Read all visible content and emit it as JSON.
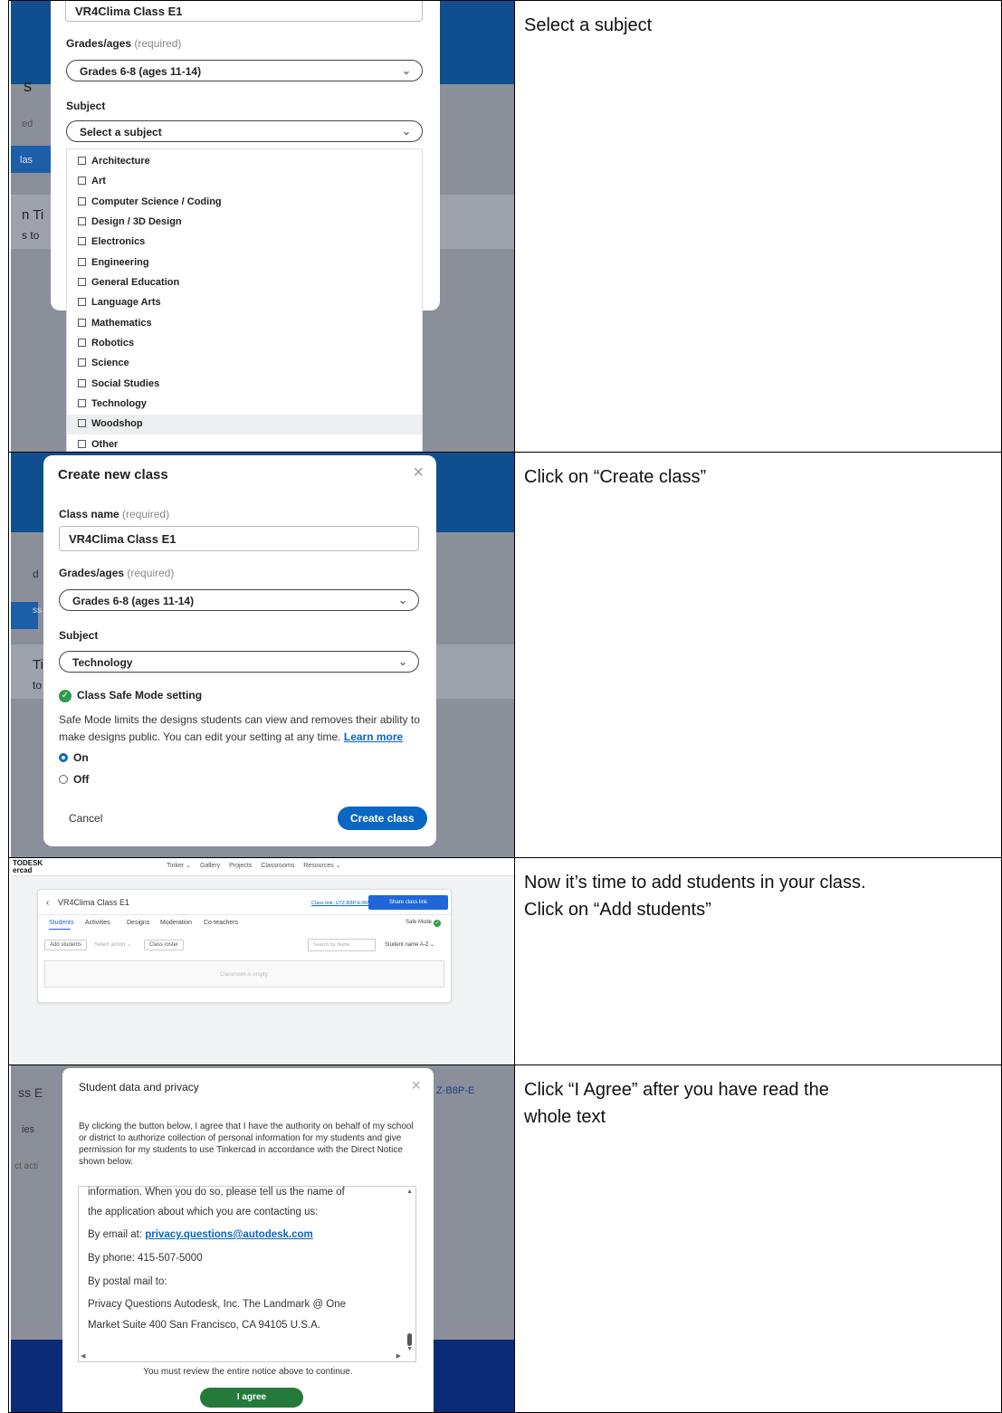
{
  "steps": [
    {
      "instruction": "Select a subject",
      "screen": {
        "class_name_value": "VR4Clima Class E1",
        "grades_label": "Grades/ages",
        "required_text": "(required)",
        "grades_value": "Grades 6-8 (ages 11-14)",
        "subject_label": "Subject",
        "subject_placeholder": "Select a subject",
        "bg_fragments": [
          "s",
          "ed",
          "las",
          "n Ti",
          "s to"
        ],
        "subjects": [
          "Architecture",
          "Art",
          "Computer Science / Coding",
          "Design / 3D Design",
          "Electronics",
          "Engineering",
          "General Education",
          "Language Arts",
          "Mathematics",
          "Robotics",
          "Science",
          "Social Studies",
          "Technology",
          "Woodshop",
          "Other"
        ],
        "highlighted": "Woodshop"
      }
    },
    {
      "instruction": "Click on “Create class”",
      "screen": {
        "title": "Create new class",
        "class_name_label": "Class name",
        "required_text": "(required)",
        "class_name_value": "VR4Clima Class E1",
        "grades_label": "Grades/ages",
        "grades_value": "Grades 6-8 (ages 11-14)",
        "subject_label": "Subject",
        "subject_value": "Technology",
        "safe_mode_heading": "Class Safe Mode setting",
        "safe_mode_text_1": "Safe Mode limits the designs students can view and removes their ability to",
        "safe_mode_text_2": "make designs public. You can edit your setting at any time.",
        "learn_more": "Learn more",
        "radio_on": "On",
        "radio_off": "Off",
        "cancel": "Cancel",
        "create": "Create class",
        "bg_fragments": [
          "d",
          "ss",
          "Ti",
          "to"
        ]
      }
    },
    {
      "instruction_1": "Now it’s time to add students in your class.",
      "instruction_2": "Click on “Add students”",
      "screen": {
        "logo_1": "TODESK",
        "logo_2": "ercad",
        "nav": [
          "Tinker ⌄",
          "Gallery",
          "Projects",
          "Classrooms",
          "Resources ⌄"
        ],
        "class_title": "VR4Clima Class E1",
        "class_link": "Class link: U7Z-B8P-E3W",
        "share_button": "Share class link",
        "tabs": [
          "Students",
          "Activities",
          "Designs",
          "Moderation",
          "Co-teachers"
        ],
        "safe_mode": "Safe Mode",
        "add_students": "Add students",
        "select_action": "Select action ⌄",
        "class_roster": "Class roster",
        "search_placeholder": "Search by Name",
        "sort": "Student name A-Z ⌄",
        "empty": "Classroom is empty."
      }
    },
    {
      "instruction_1": "Click “I Agree” after you have read the",
      "instruction_2": "whole text",
      "screen": {
        "title": "Student data and privacy",
        "intro": "By clicking the button below, I agree that I have the authority on behalf of my school or district to authorize collection of personal information for my students and give permission for my students to use Tinkercad in accordance with the Direct Notice shown below.",
        "notice_line_1": "information. When you do so, please tell us the name of",
        "notice_line_2": "the application about which you are contacting us:",
        "email_label": "By email at:",
        "email": "privacy.questions@autodesk.com",
        "phone": "By phone: 415-507-5000",
        "postal": "By postal mail to:",
        "address_1": "Privacy Questions Autodesk, Inc. The Landmark @ One",
        "address_2": "Market Suite 400 San Francisco, CA 94105 U.S.A.",
        "review": "You must review the entire notice above to continue.",
        "agree": "I agree",
        "bg_fragments": [
          "ss E",
          "ies",
          "ct acti",
          "Z-B8P-E"
        ]
      }
    }
  ]
}
